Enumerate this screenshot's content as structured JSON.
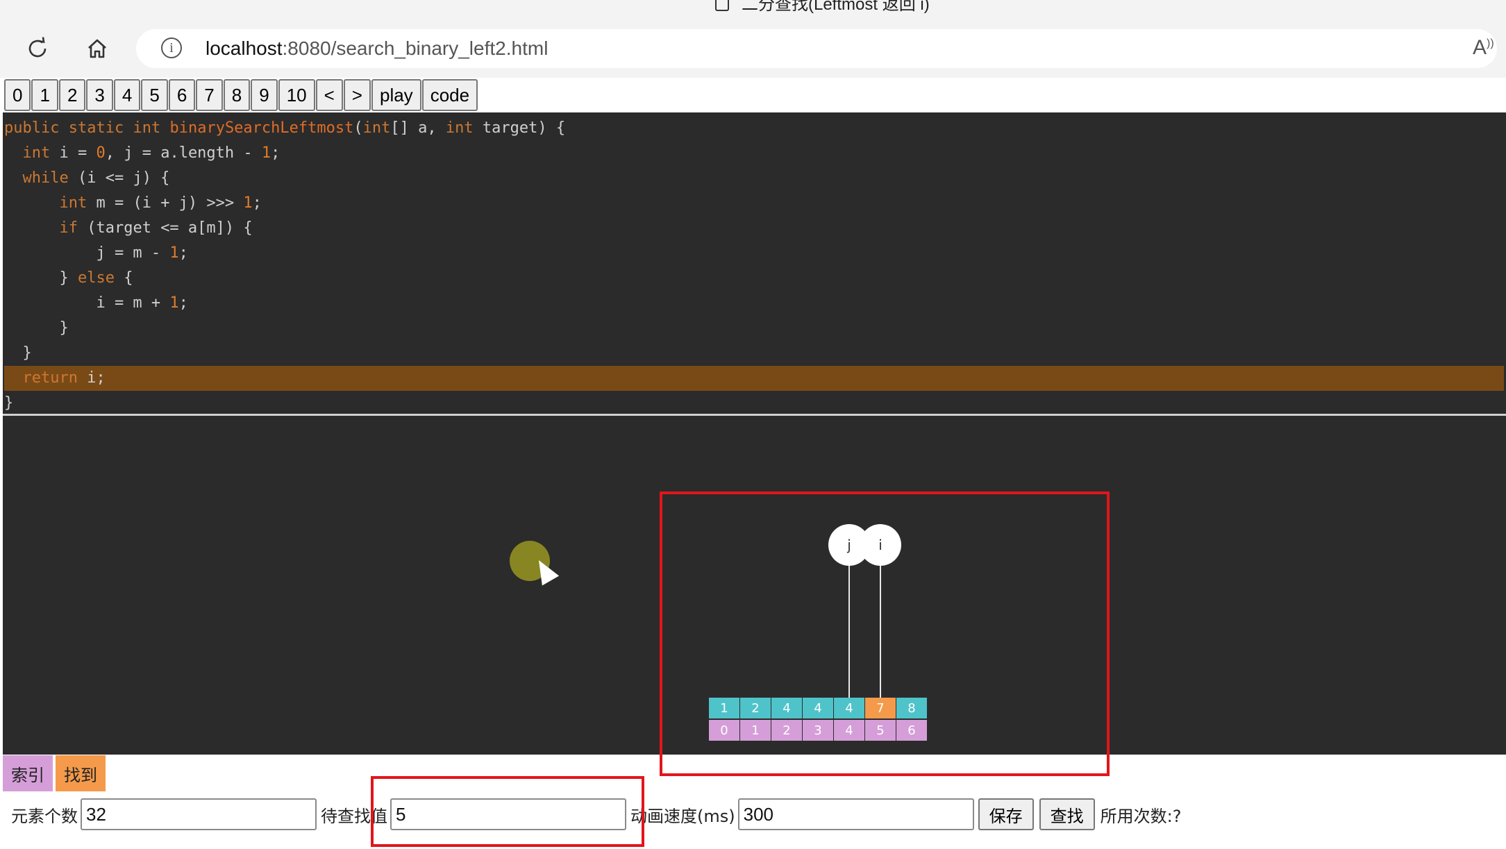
{
  "browser": {
    "tab_title": "二分查找(Leftmost 返回 i)",
    "url_host": "localhost",
    "url_path": ":8080/search_binary_left2.html",
    "read_aloud": "A))"
  },
  "step_buttons": [
    "0",
    "1",
    "2",
    "3",
    "4",
    "5",
    "6",
    "7",
    "8",
    "9",
    "10",
    "<",
    ">",
    "play",
    "code"
  ],
  "code": {
    "active_line": 11,
    "lines": [
      "public static int binarySearchLeftmost(int[] a, int target) {",
      "  int i = 0, j = a.length - 1;",
      "  while (i <= j) {",
      "      int m = (i + j) >>> 1;",
      "      if (target <= a[m]) {",
      "          j = m - 1;",
      "      } else {",
      "          i = m + 1;",
      "      }",
      "  }",
      "  return i;",
      "}"
    ]
  },
  "array_viz": {
    "values": [
      "1",
      "2",
      "4",
      "4",
      "4",
      "7",
      "8"
    ],
    "indices": [
      "0",
      "1",
      "2",
      "3",
      "4",
      "5",
      "6"
    ],
    "highlight_index": 5,
    "pointers": [
      {
        "label": "j",
        "index": 4
      },
      {
        "label": "i",
        "index": 5
      }
    ],
    "colors": {
      "value_cell": "#4fc3ca",
      "highlight_cell": "#f49a4a",
      "index_cell": "#d59ed8",
      "panel_bg": "#2b2b2b",
      "annotation": "#e2151b"
    }
  },
  "legend": {
    "index_label": "索引",
    "found_label": "找到"
  },
  "controls": {
    "count_label": "元素个数",
    "count_value": "32",
    "target_label": "待查找值",
    "target_value": "5",
    "speed_label": "动画速度(ms)",
    "speed_value": "300",
    "save_label": "保存",
    "search_label": "查找",
    "attempts_label": "所用次数:?"
  }
}
